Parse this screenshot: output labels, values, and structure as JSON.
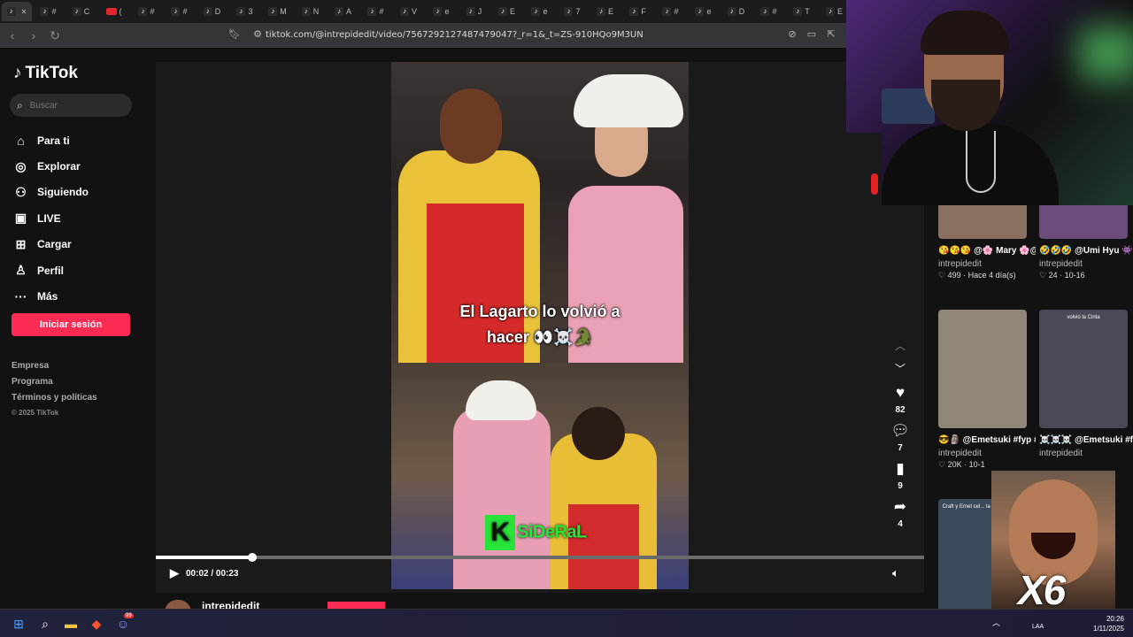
{
  "browser": {
    "tabs": [
      {
        "glyph": "♪",
        "label": "",
        "active": true
      },
      {
        "glyph": "♪",
        "label": "#"
      },
      {
        "glyph": "♪",
        "label": "C"
      },
      {
        "glyph": "",
        "label": "(",
        "youtube": true
      },
      {
        "glyph": "♪",
        "label": "#"
      },
      {
        "glyph": "♪",
        "label": "#"
      },
      {
        "glyph": "♪",
        "label": "D"
      },
      {
        "glyph": "♪",
        "label": "3"
      },
      {
        "glyph": "♪",
        "label": "M"
      },
      {
        "glyph": "♪",
        "label": "N"
      },
      {
        "glyph": "♪",
        "label": "A"
      },
      {
        "glyph": "♪",
        "label": "#"
      },
      {
        "glyph": "♪",
        "label": "V"
      },
      {
        "glyph": "♪",
        "label": "e"
      },
      {
        "glyph": "♪",
        "label": "J"
      },
      {
        "glyph": "♪",
        "label": "E"
      },
      {
        "glyph": "♪",
        "label": "e"
      },
      {
        "glyph": "♪",
        "label": "7"
      },
      {
        "glyph": "♪",
        "label": "E"
      },
      {
        "glyph": "♪",
        "label": "F"
      },
      {
        "glyph": "♪",
        "label": "#"
      },
      {
        "glyph": "♪",
        "label": "e"
      },
      {
        "glyph": "♪",
        "label": "D"
      },
      {
        "glyph": "♪",
        "label": "#"
      },
      {
        "glyph": "♪",
        "label": "T"
      },
      {
        "glyph": "♪",
        "label": "E"
      }
    ],
    "url": "tiktok.com/@intrepidedit/video/7567292127487479047?_r=1&_t=ZS-910HQo9M3UN"
  },
  "tiktok": {
    "logo": "TikTok",
    "search_placeholder": "Buscar",
    "nav": [
      {
        "label": "Para ti",
        "icon": "home-icon",
        "glyph": "⌂"
      },
      {
        "label": "Explorar",
        "icon": "compass-icon",
        "glyph": "◎"
      },
      {
        "label": "Siguiendo",
        "icon": "following-icon",
        "glyph": "⚇"
      },
      {
        "label": "LIVE",
        "icon": "live-icon",
        "glyph": "▣"
      },
      {
        "label": "Cargar",
        "icon": "upload-icon",
        "glyph": "⊞"
      },
      {
        "label": "Perfil",
        "icon": "profile-icon",
        "glyph": "♙"
      },
      {
        "label": "Más",
        "icon": "more-icon",
        "glyph": "···"
      }
    ],
    "login_label": "Iniciar sesión",
    "footer": [
      "Empresa",
      "Programa",
      "Términos y políticas"
    ],
    "copyright": "© 2025 TikTok"
  },
  "video": {
    "caption_line1": "El Lagarto lo volvió a",
    "caption_line2": "hacer 👀☠️🐊",
    "watermark": "SiDeRaL",
    "watermark_k": "K",
    "time": "00:02 / 00:23",
    "progress": 0.125,
    "likes": "82",
    "comments": "7",
    "saves": "9",
    "shares": "4",
    "author": "intrepidedit"
  },
  "related": [
    {
      "desc": "😘😘😘 @🌸 Mary 🌸@Julieta 💗...",
      "user": "intrepidedit",
      "stat": "♡ 499 · Hace 4 día(s)",
      "thumb": "#8a7060"
    },
    {
      "desc": "🤣🤣🤣 @Umi Hyu 👾 #fyp #dota #ki...",
      "user": "intrepidedit",
      "stat": "♡ 24 · 10-16",
      "thumb": "#6a4b7a"
    },
    {
      "desc": "😎🗿 @Emetsuki #fyp #humor...",
      "user": "intrepidedit",
      "stat": "♡ 20K · 10-1",
      "thumb": "#8f8677",
      "overlay": ""
    },
    {
      "desc": "☠️☠️☠️ @Emetsuki #fyp #humor #per...",
      "user": "intrepidedit",
      "stat": "",
      "thumb": "#4b4957",
      "overlay": "volvió la Cinta"
    },
    {
      "desc": "",
      "user": "",
      "stat": "",
      "thumb": "#3a4a5a",
      "overlay": "Craft y Emet cel... la salida de D..."
    }
  ],
  "overlay_text": "X6",
  "taskbar": {
    "time": "20:26",
    "date": "1/11/2025",
    "lang": "LAA",
    "discord_badge": "99"
  }
}
